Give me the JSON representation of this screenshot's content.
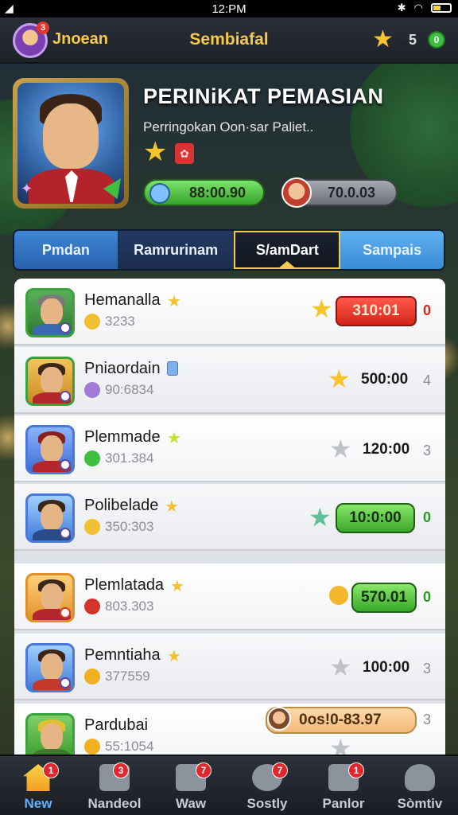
{
  "status_bar": {
    "time": "12:PM",
    "signal_icon": "signal-icon",
    "bluetooth_icon": "bluetooth-icon",
    "wifi_icon": "wifi-icon",
    "battery_icon": "battery-icon"
  },
  "app_bar": {
    "user": "Jnoean",
    "avatar_badge": "3",
    "title": "Sembiafal",
    "currency_count": "5",
    "coin_label": "0"
  },
  "hero": {
    "title": "PERINiKAT PEMASIAN",
    "subtitle": "Perringokan Oon·sar Paliet..",
    "stat_primary": "88:00.90",
    "stat_secondary": "70.0.03"
  },
  "tabs": [
    {
      "label": "Pmdan"
    },
    {
      "label": "Ramrurinam"
    },
    {
      "label": "S/amDart"
    },
    {
      "label": "Sampais"
    }
  ],
  "leaderboard": [
    {
      "name": "Hemanalla",
      "sub": "3233",
      "score": "310:01",
      "rank": "0"
    },
    {
      "name": "Pniaordain",
      "sub": "90:6834",
      "score": "500:00",
      "rank": "4"
    },
    {
      "name": "Plemmade",
      "sub": "301.384",
      "score": "120:00",
      "rank": "3"
    },
    {
      "name": "Polibelade",
      "sub": "350:303",
      "score": "10:0:00",
      "rank": "0"
    },
    {
      "name": "Plemlatada",
      "sub": "803.303",
      "score": "570.01",
      "rank": "0"
    },
    {
      "name": "Pemntiaha",
      "sub": "377559",
      "score": "100:00",
      "rank": "3"
    },
    {
      "name": "Pardubai",
      "sub": "55:1054",
      "score": "0os!0-83.97",
      "rank": "3"
    }
  ],
  "bottom_nav": [
    {
      "label": "New",
      "badge": "1"
    },
    {
      "label": "Nandeol",
      "badge": "3"
    },
    {
      "label": "Waw",
      "badge": "7"
    },
    {
      "label": "Sostly",
      "badge": "7"
    },
    {
      "label": "Panlor",
      "badge": "1"
    },
    {
      "label": "Sòmtiv",
      "badge": ""
    }
  ],
  "colors": {
    "gold": "#f5c94a",
    "red": "#d4251b",
    "green": "#3aa82a",
    "blue": "#3a8ad6"
  }
}
